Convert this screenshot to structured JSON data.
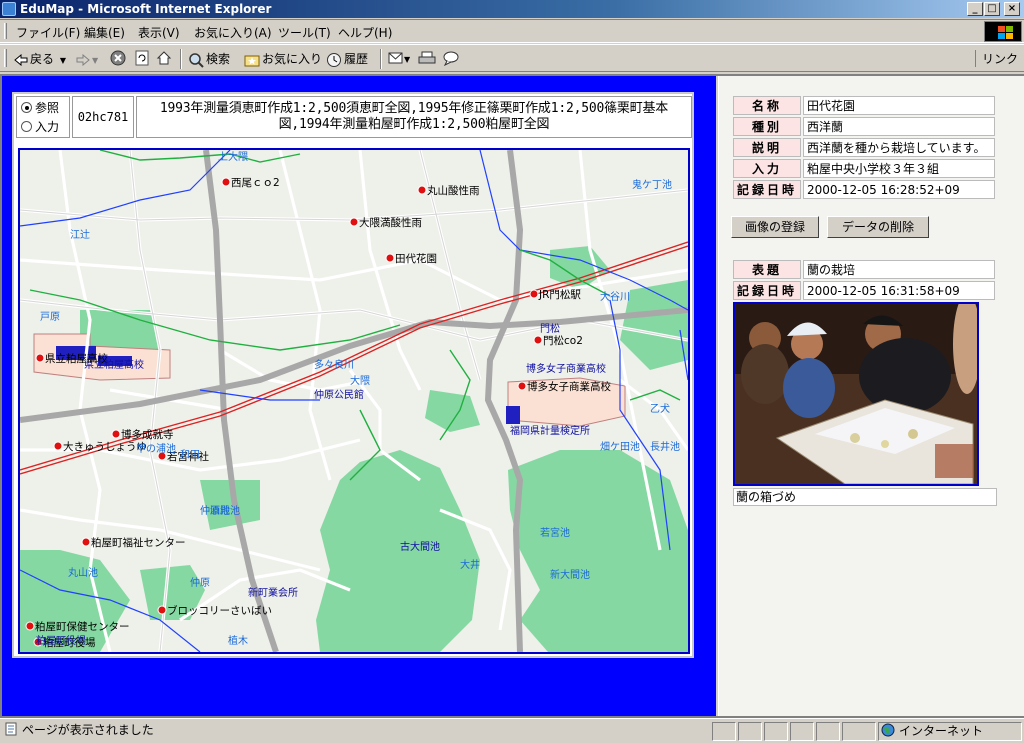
{
  "window": {
    "title": "EduMap - Microsoft Internet Explorer",
    "minimize_label": "_",
    "maximize_label": "□",
    "close_label": "×"
  },
  "menu": [
    "ファイル(F)",
    "編集(E)",
    "表示(V)",
    "お気に入り(A)",
    "ツール(T)",
    "ヘルプ(H)"
  ],
  "toolbar": {
    "back_label": "戻る",
    "search_label": "検索",
    "favorites_label": "お気に入り",
    "history_label": "履歴",
    "links_label": "リンク"
  },
  "map": {
    "mode_ref_label": "参照",
    "mode_input_label": "入力",
    "map_id": "02hc781",
    "source_text": "1993年測量須恵町作成1:2,500須恵町全図,1995年修正篠栗町作成1:2,500篠栗町基本図,1994年測量粕屋町作成1:2,500粕屋町全図",
    "markers": [
      {
        "label": "西尾ｃｏ2"
      },
      {
        "label": "丸山酸性雨"
      },
      {
        "label": "大隈満酸性雨"
      },
      {
        "label": "田代花園"
      },
      {
        "label": "JR門松駅"
      },
      {
        "label": "門松co2"
      },
      {
        "label": "博多女子商業高校"
      },
      {
        "label": "県立粕屋高校"
      },
      {
        "label": "博多成就寺"
      },
      {
        "label": "大きゅうしょうゆ"
      },
      {
        "label": "若宮神社"
      },
      {
        "label": "粕屋町福祉センター"
      },
      {
        "label": "ブロッコリーさいばい"
      },
      {
        "label": "粕屋町保健センター"
      },
      {
        "label": "粕屋町役場"
      }
    ],
    "place_names": {
      "blue": [
        "上大隈",
        "江辻",
        "戸原",
        "大隈",
        "多々良川",
        "仲原",
        "丸山池",
        "大谷川",
        "乙犬",
        "畑ケ田池",
        "長井池",
        "甲の浦池",
        "仲原池",
        "酒殿池",
        "大井",
        "若宮池",
        "新大間池",
        "植木",
        "鬼ケ丁池",
        "和田"
      ],
      "black": [
        "県立粕屋高校",
        "博多女子商業高校",
        "門松",
        "福岡県計量検定所",
        "新町業会所",
        "古大間池",
        "粕屋町役場",
        "仲原公民館"
      ]
    }
  },
  "detail": {
    "rows": [
      {
        "key": "名称",
        "value": "田代花園"
      },
      {
        "key": "種別",
        "value": "西洋蘭"
      },
      {
        "key": "説明",
        "value": "西洋蘭を種から栽培しています。"
      },
      {
        "key": "入力",
        "value": "粕屋中央小学校３年３組"
      },
      {
        "key": "記録日時",
        "value": "2000-12-05 16:28:52+09"
      }
    ],
    "register_image_label": "画像の登録",
    "delete_data_label": "データの削除"
  },
  "photo": {
    "rows": [
      {
        "key": "表題",
        "value": "蘭の栽培"
      },
      {
        "key": "記録日時",
        "value": "2000-12-05 16:31:58+09"
      }
    ],
    "caption": "蘭の箱づめ"
  },
  "status": {
    "message": "ページが表示されました",
    "zone": "インターネット"
  }
}
